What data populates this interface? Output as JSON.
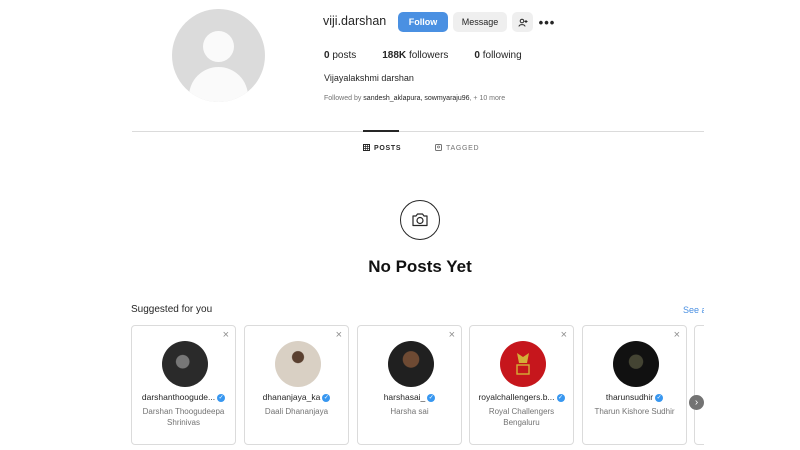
{
  "profile": {
    "username": "viji.darshan",
    "follow_label": "Follow",
    "message_label": "Message",
    "add_user_icon": "add-user-icon",
    "more_icon": "more-options-icon",
    "posts_count": "0",
    "posts_label": "posts",
    "followers_count": "188K",
    "followers_label": "followers",
    "following_count": "0",
    "following_label": "following",
    "full_name": "Vijayalakshmi darshan",
    "followed_by_prefix": "Followed by ",
    "followed_by_users": "sandesh_aklapura, sowmyaraju96",
    "followed_by_suffix": ", + 10 more"
  },
  "tabs": {
    "posts_label": "POSTS",
    "tagged_label": "TAGGED"
  },
  "empty_state": {
    "title": "No Posts Yet"
  },
  "suggested": {
    "title": "Suggested for you",
    "see_all": "See all",
    "cards": [
      {
        "handle": "darshanthoogude...",
        "name": "Darshan Thoogudeepa Shrinivas"
      },
      {
        "handle": "dhananjaya_ka",
        "name": "Daali Dhananjaya"
      },
      {
        "handle": "harshasai_",
        "name": "Harsha sai"
      },
      {
        "handle": "royalchallengers.b...",
        "name": "Royal Challengers Bengaluru"
      },
      {
        "handle": "tharunsudhir",
        "name": "Tharun Kishore Sudhir"
      }
    ]
  },
  "colors": {
    "accent": "#4a90e2",
    "verified": "#3897f0"
  }
}
